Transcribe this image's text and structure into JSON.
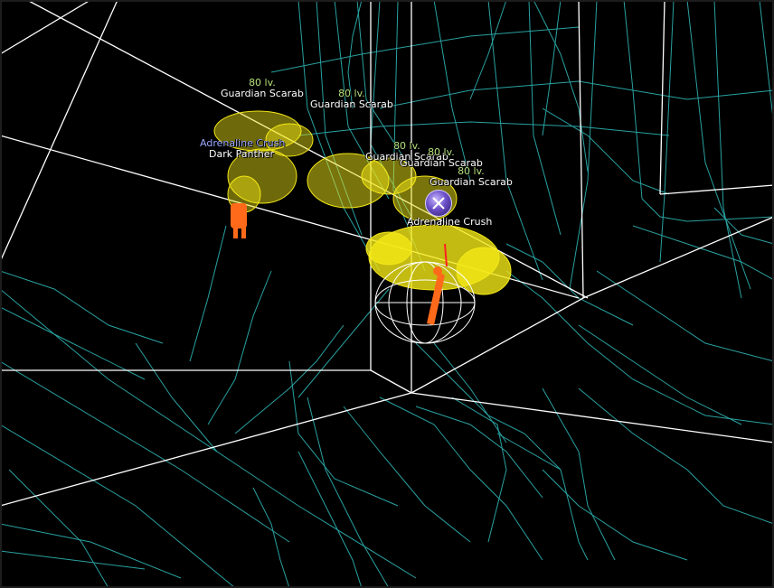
{
  "nameplates": [
    {
      "level": "80 lv.",
      "name": "Guardian Scarab"
    },
    {
      "level": "80 lv.",
      "name": "Guardian Scarab"
    },
    {
      "level": "80 lv.",
      "name": "Guardian Scarab"
    },
    {
      "level": "80 lv.",
      "name": "Guardian Scarab"
    },
    {
      "level": "80 lv.",
      "name": "Guardian Scarab"
    }
  ],
  "pet": {
    "buff": "Adrenaline Crush",
    "name": "Dark Panther"
  },
  "player": {
    "buff": "Adrenaline Crush"
  },
  "colors": {
    "wire": "#2fb3b3",
    "wire_bright": "#ffffff",
    "mob_mesh": "#f4e817",
    "orange_figure": "#ff6a1a",
    "level_text": "#b4e07a",
    "buff_text": "#9aa6ff",
    "background": "#000000"
  },
  "icons": {
    "target_marker": "crossed-swords-icon"
  }
}
